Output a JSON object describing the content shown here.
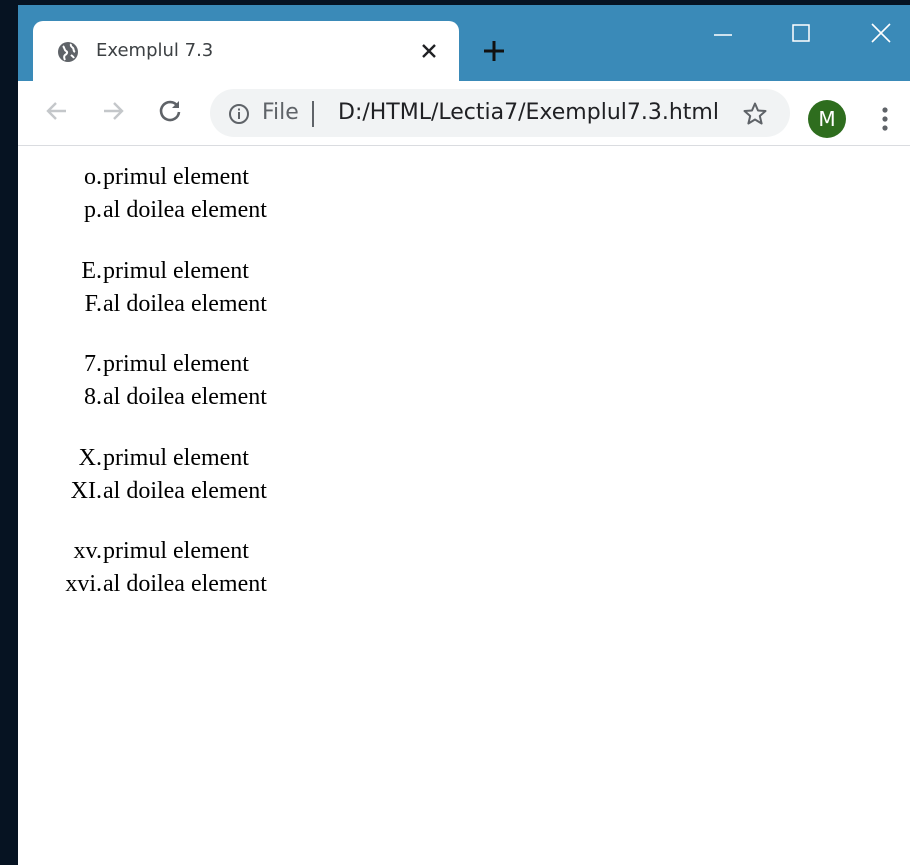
{
  "browser": {
    "tab": {
      "title": "Exemplul 7.3"
    },
    "omnibox": {
      "scheme_label": "File",
      "url": "D:/HTML/Lectia7/Exemplul7.3.html"
    },
    "profile_initial": "M",
    "colors": {
      "titlebar": "#3a8ab8",
      "avatar": "#2e6d1e"
    },
    "icons": {
      "tab_favicon": "globe-icon",
      "tab_close": "close-icon",
      "new_tab": "plus-icon",
      "minimize": "minimize-icon",
      "maximize": "maximize-icon",
      "close_window": "close-icon",
      "back": "back-arrow-icon",
      "forward": "forward-arrow-icon",
      "reload": "reload-icon",
      "site_info": "info-icon",
      "bookmark": "star-icon",
      "menu": "kebab-menu-icon"
    }
  },
  "page": {
    "lists": [
      {
        "items": [
          {
            "marker": "o.",
            "text": "primul element"
          },
          {
            "marker": "p.",
            "text": "al doilea element"
          }
        ]
      },
      {
        "items": [
          {
            "marker": "E.",
            "text": "primul element"
          },
          {
            "marker": "F.",
            "text": "al doilea element"
          }
        ]
      },
      {
        "items": [
          {
            "marker": "7.",
            "text": "primul element"
          },
          {
            "marker": "8.",
            "text": "al doilea element"
          }
        ]
      },
      {
        "items": [
          {
            "marker": "X.",
            "text": "primul element"
          },
          {
            "marker": "XI.",
            "text": "al doilea element"
          }
        ]
      },
      {
        "items": [
          {
            "marker": "xv.",
            "text": "primul element"
          },
          {
            "marker": "xvi.",
            "text": "al doilea element"
          }
        ]
      }
    ]
  }
}
